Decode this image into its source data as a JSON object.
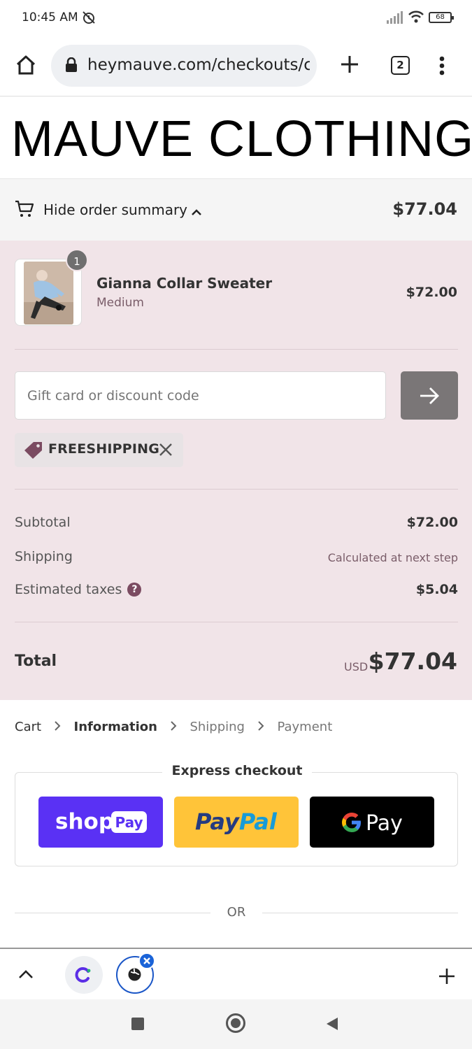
{
  "status_bar": {
    "time": "10:45 AM",
    "battery": "68"
  },
  "browser": {
    "url": "heymauve.com/checkouts/c/",
    "tab_count": "2"
  },
  "brand": {
    "name": "MAUVE CLOTHING"
  },
  "summary_toggle": {
    "label": "Hide order summary",
    "total": "$77.04"
  },
  "line_item": {
    "quantity": "1",
    "name": "Gianna Collar Sweater",
    "variant": "Medium",
    "price": "$72.00"
  },
  "discount": {
    "placeholder": "Gift card or discount code",
    "applied_code": "FREESHIPPING"
  },
  "totals": {
    "subtotal_label": "Subtotal",
    "subtotal_value": "$72.00",
    "shipping_label": "Shipping",
    "shipping_value": "Calculated at next step",
    "taxes_label": "Estimated taxes",
    "taxes_value": "$5.04",
    "total_label": "Total",
    "currency": "USD",
    "total_value": "$77.04"
  },
  "breadcrumb": [
    "Cart",
    "Information",
    "Shipping",
    "Payment"
  ],
  "express": {
    "title": "Express checkout",
    "shop_pay": {
      "word": "shop",
      "badge": "Pay"
    },
    "paypal": {
      "pay": "Pay",
      "pal": "Pal"
    },
    "gpay": {
      "label": "Pay"
    }
  },
  "divider_text": "OR",
  "colors": {
    "accent": "#7b4b61",
    "panel": "#f1e4e8",
    "shop_pay": "#5a31f4",
    "paypal": "#ffc439"
  }
}
